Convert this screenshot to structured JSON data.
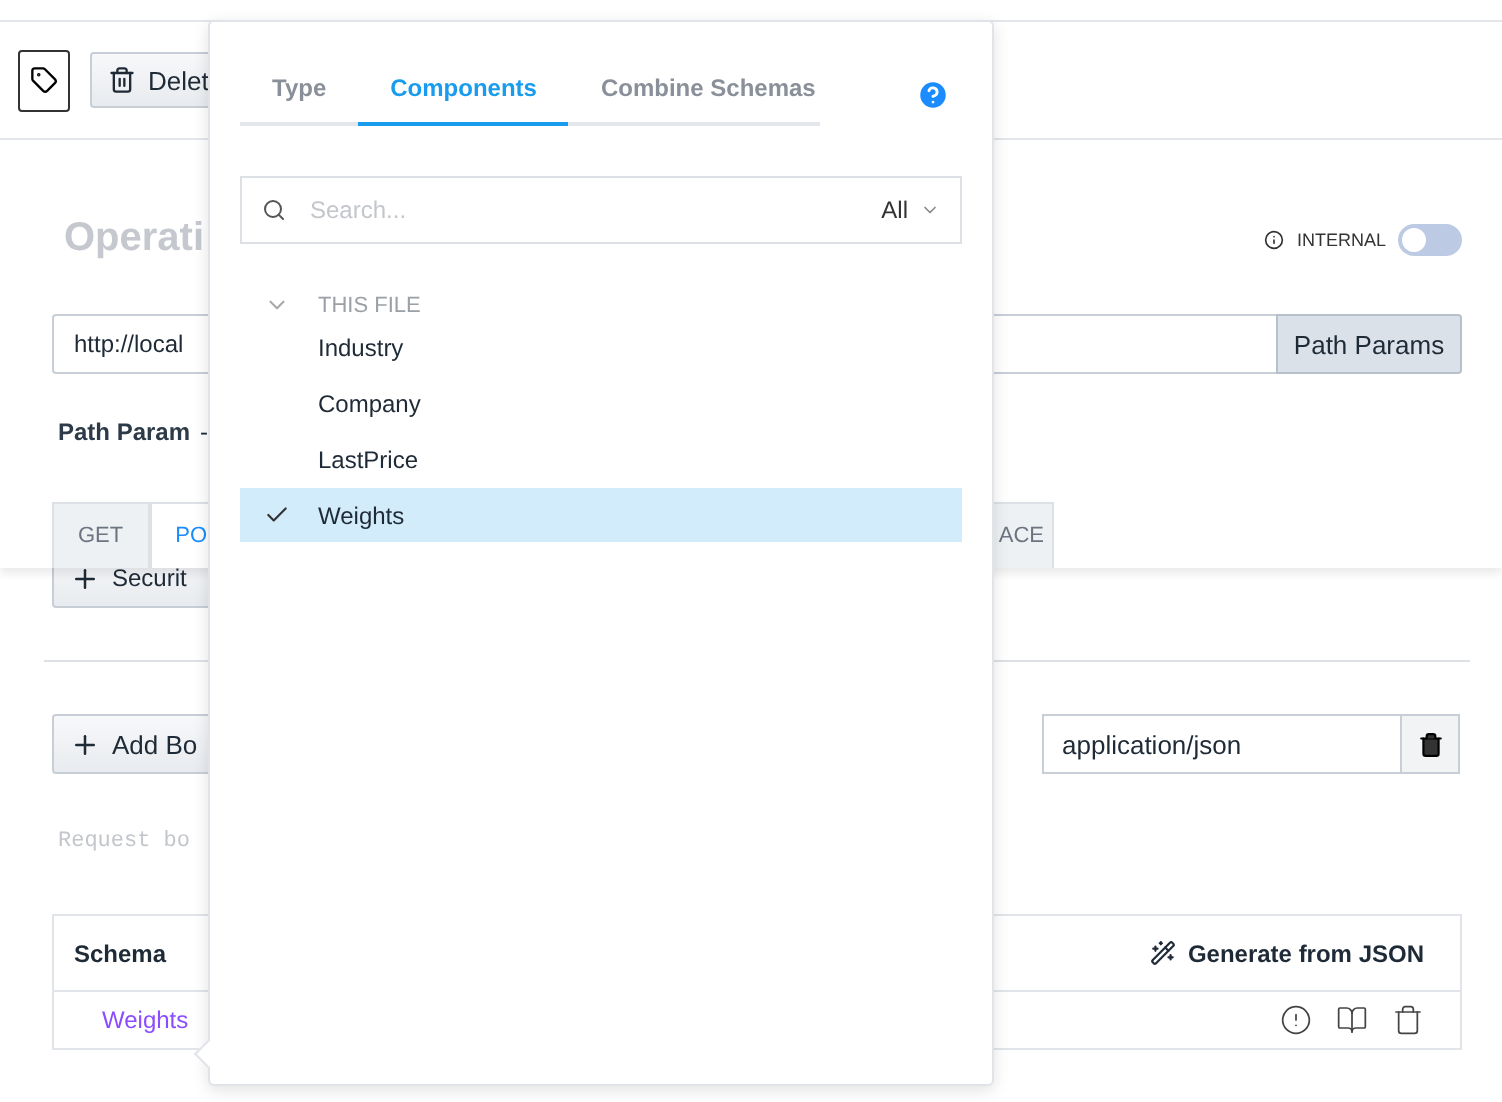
{
  "toolbar": {
    "delete_label": "Delet"
  },
  "operation": {
    "title": "Operati",
    "internal": {
      "label": "INTERNAL",
      "on": false
    }
  },
  "url": {
    "value": "http://local",
    "button": "Path Params"
  },
  "path_params": {
    "label": "Path Param",
    "value": "-"
  },
  "method_tabs": [
    {
      "label": "GET",
      "selected": false
    },
    {
      "label": "PO",
      "selected": true
    },
    {
      "label": "ACE",
      "selected": false
    }
  ],
  "security_button": "Securit",
  "body": {
    "add_button": "Add Bo",
    "content_type": "application/json",
    "placeholder": "Request bo"
  },
  "schema_table": {
    "header": "Schema",
    "generate_button": "Generate from JSON",
    "value": "Weights"
  },
  "popover": {
    "tabs": [
      {
        "label": "Type",
        "selected": false
      },
      {
        "label": "Components",
        "selected": true
      },
      {
        "label": "Combine Schemas",
        "selected": false
      }
    ],
    "search": {
      "placeholder": "Search...",
      "filter": "All"
    },
    "group": {
      "label": "THIS FILE",
      "expanded": true,
      "items": [
        {
          "label": "Industry",
          "selected": false
        },
        {
          "label": "Company",
          "selected": false
        },
        {
          "label": "LastPrice",
          "selected": false
        },
        {
          "label": "Weights",
          "selected": true
        }
      ]
    }
  }
}
